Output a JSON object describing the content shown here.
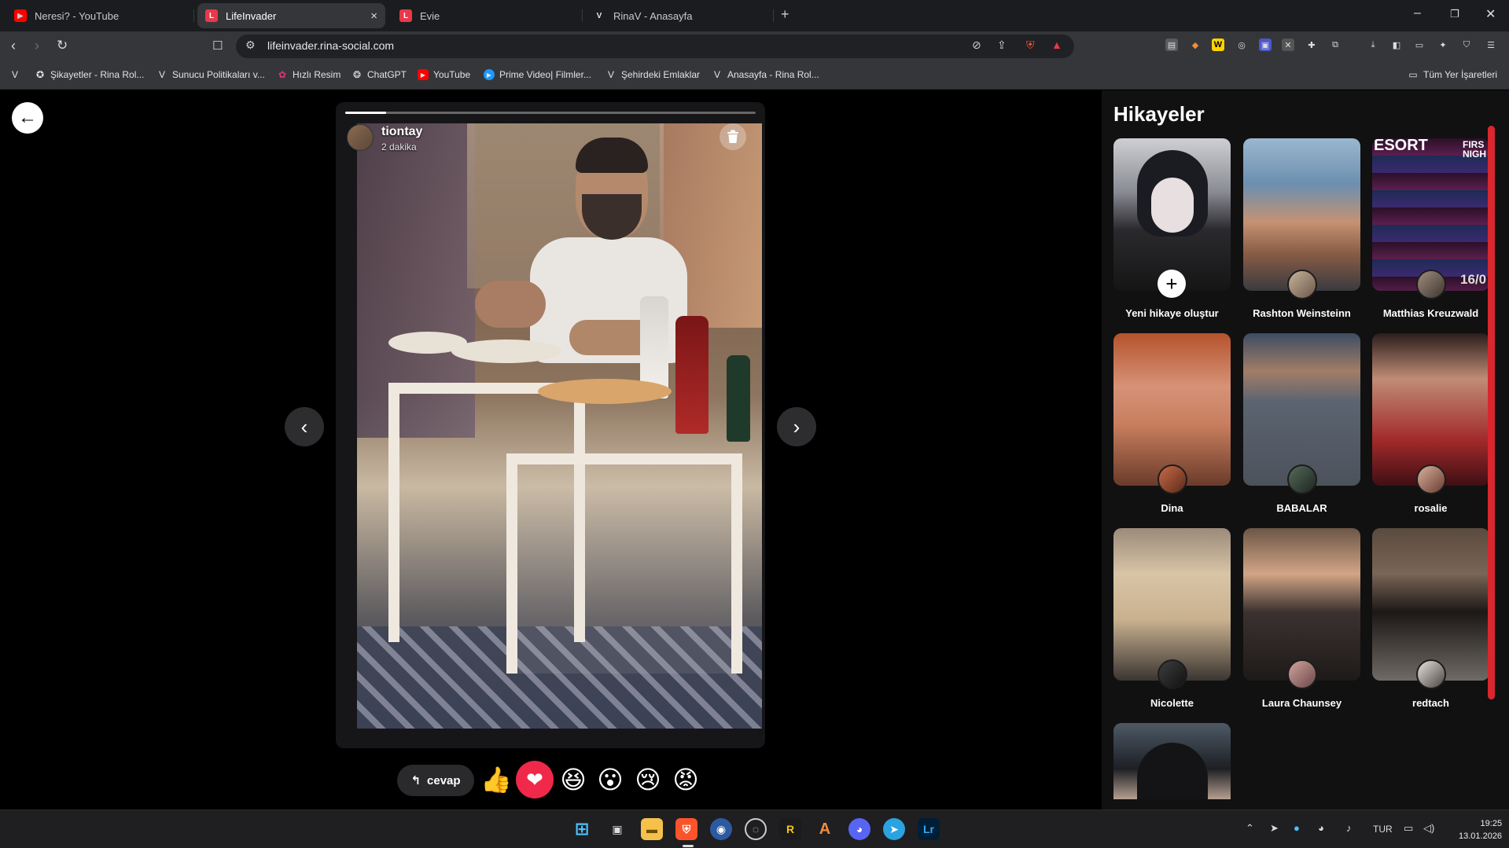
{
  "browser": {
    "tabs": [
      {
        "title": "Neresi? - YouTube",
        "favicon": "youtube-icon"
      },
      {
        "title": "LifeInvader",
        "favicon": "lifeinvader-icon",
        "active": true
      },
      {
        "title": "Evie",
        "favicon": "lifeinvader-icon"
      },
      {
        "title": "RinaV - Anasayfa",
        "favicon": "v-logo-icon"
      }
    ],
    "tab_close": "×",
    "new_tab": "+",
    "window_controls": {
      "minimize": "–",
      "restore": "❐",
      "close": "✕"
    },
    "url": "lifeinvader.rina-social.com",
    "bookmarks": [
      {
        "label": "Şikayetler - Rina Rol...",
        "icon": "v-logo-icon"
      },
      {
        "label": "Sunucu Politikaları v...",
        "icon": "v-logo-icon"
      },
      {
        "label": "Hızlı Resim",
        "icon": "image-icon"
      },
      {
        "label": "ChatGPT",
        "icon": "chatgpt-icon"
      },
      {
        "label": "YouTube",
        "icon": "youtube-icon"
      },
      {
        "label": "Prime Video| Filmler...",
        "icon": "prime-video-icon"
      },
      {
        "label": "Şehirdeki Emlaklar",
        "icon": "v-logo-icon"
      },
      {
        "label": "Anasayfa - Rina Rol...",
        "icon": "v-logo-icon"
      }
    ],
    "all_bookmarks": "Tüm Yer İşaretleri"
  },
  "story": {
    "username": "tiontay",
    "time": "2 dakika",
    "progress": 0.1,
    "reply_label": "cevap",
    "reactions": [
      {
        "name": "like-reaction",
        "glyph": "👍",
        "bg": "transparent"
      },
      {
        "name": "love-reaction",
        "glyph": "❤",
        "bg": "#f02849"
      },
      {
        "name": "haha-reaction",
        "glyph": "😆",
        "bg": "transparent"
      },
      {
        "name": "wow-reaction",
        "glyph": "😮",
        "bg": "transparent"
      },
      {
        "name": "sad-reaction",
        "glyph": "😢",
        "bg": "transparent"
      },
      {
        "name": "angry-reaction",
        "glyph": "😡",
        "bg": "transparent"
      }
    ]
  },
  "sidebar": {
    "title": "Hikayeler",
    "stories": [
      {
        "label": "Yeni hikaye oluştur",
        "type": "create"
      },
      {
        "label": "Rashton Weinsteinn"
      },
      {
        "label": "Matthias Kreuzwald"
      },
      {
        "label": "Dina"
      },
      {
        "label": "BABALAR"
      },
      {
        "label": "rosalie"
      },
      {
        "label": "Nicolette"
      },
      {
        "label": "Laura Chaunsey"
      },
      {
        "label": "redtach"
      },
      {
        "label": ""
      }
    ],
    "poster_text_1": "ESORT",
    "poster_text_2": "FIRS NIGH",
    "poster_date": "16/0"
  },
  "taskbar": {
    "lang": "TUR",
    "time": "19:25",
    "date": "13.01.2026",
    "lightroom_label": "Lr"
  },
  "colors": {
    "accent_red": "#d9262f",
    "love_red": "#f02849",
    "sidebar_bg": "#111111"
  }
}
